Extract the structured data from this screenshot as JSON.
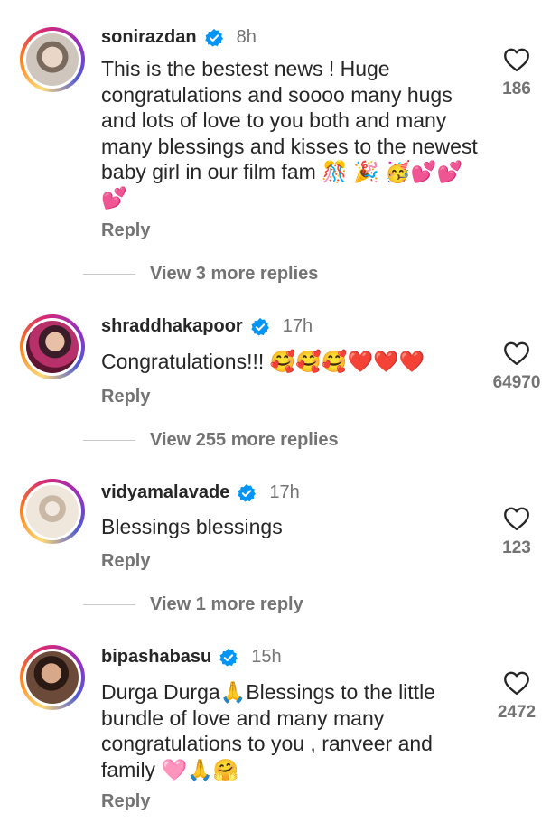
{
  "comments": [
    {
      "username": "sonirazdan",
      "time": "8h",
      "text": "This is the bestest news ! Huge congratulations and soooo many hugs and lots of love to you both and many many blessings and kisses to the newest baby girl in our film fam 🎊 🎉 🥳💕💕💕",
      "likes": "186",
      "reply_label": "Reply",
      "more_replies": "View 3 more replies"
    },
    {
      "username": "shraddhakapoor",
      "time": "17h",
      "text": "Congratulations!!! 🥰🥰🥰❤️❤️❤️",
      "likes": "64970",
      "reply_label": "Reply",
      "more_replies": "View 255 more replies"
    },
    {
      "username": "vidyamalavade",
      "time": "17h",
      "text": "Blessings blessings",
      "likes": "123",
      "reply_label": "Reply",
      "more_replies": "View 1 more reply"
    },
    {
      "username": "bipashabasu",
      "time": "15h",
      "text": "Durga Durga🙏Blessings to the little bundle of love and many many congratulations  to you , ranveer and family 🩷🙏🤗",
      "likes": "2472",
      "reply_label": "Reply"
    }
  ],
  "icons": {
    "verified": "verified-badge-icon",
    "like": "heart-outline-icon"
  },
  "colors": {
    "verified_blue": "#0095f6",
    "secondary_text": "#737373",
    "primary_text": "#262626"
  }
}
